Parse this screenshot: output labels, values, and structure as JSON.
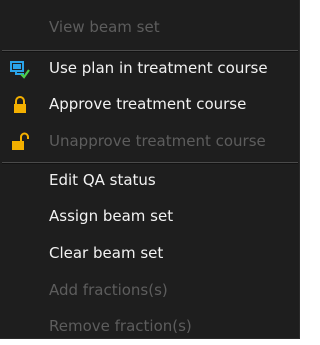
{
  "menu": {
    "items": [
      {
        "label": "View beam set",
        "enabled": false,
        "icon": ""
      },
      {
        "label": "Use plan in treatment course",
        "enabled": true,
        "icon": "plan-course-icon"
      },
      {
        "label": "Approve treatment course",
        "enabled": true,
        "icon": "lock-closed-icon"
      },
      {
        "label": "Unapprove treatment course",
        "enabled": false,
        "icon": "lock-open-icon"
      },
      {
        "label": "Edit QA status",
        "enabled": true,
        "icon": ""
      },
      {
        "label": "Assign beam set",
        "enabled": true,
        "icon": ""
      },
      {
        "label": "Clear beam set",
        "enabled": true,
        "icon": ""
      },
      {
        "label": "Add fractions(s)",
        "enabled": false,
        "icon": ""
      },
      {
        "label": "Remove fraction(s)",
        "enabled": false,
        "icon": ""
      }
    ]
  },
  "colors": {
    "menu_background": "#1e1e1e",
    "enabled_text": "#f2f2f2",
    "disabled_text": "#5d5d5d",
    "lock_icon": "#f4b000",
    "plan_icon": "#2aa3e8"
  }
}
